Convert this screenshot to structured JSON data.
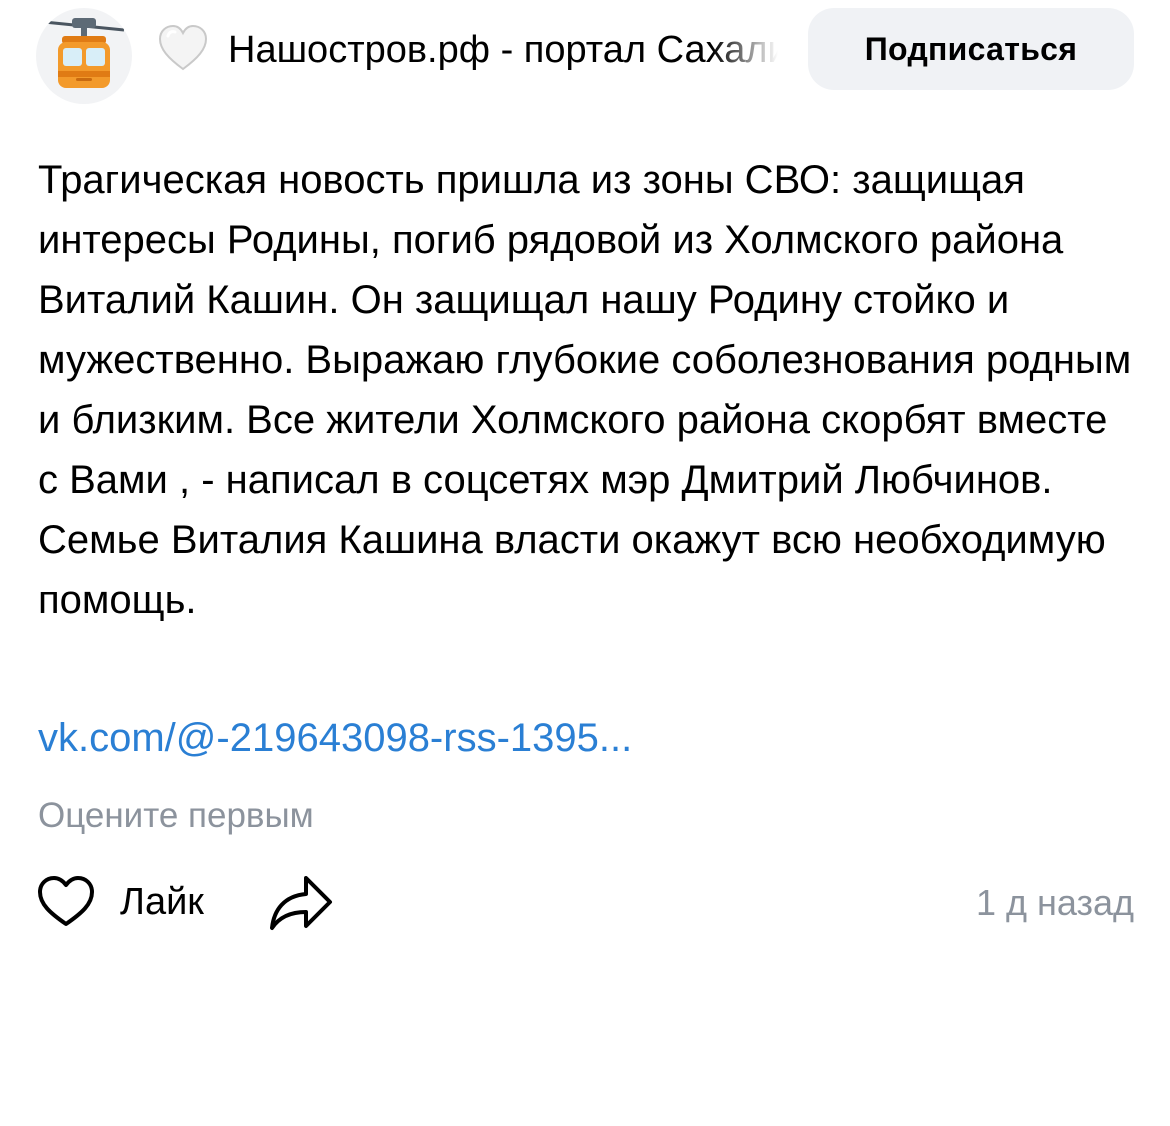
{
  "header": {
    "avatar_icon": "cable-car-icon",
    "heart_icon": "white-heart-emoji-icon",
    "channel_name": "Нашостров.рф - портал Сахалина",
    "subscribe_label": "Подписаться"
  },
  "post": {
    "text": "Трагическая новость пришла из зоны СВО: защищая интересы Родины, погиб рядовой из Холмского района Виталий Кашин. Он защищал нашу Родину стойко и мужественно. Выражаю глубокие соболезнования родным и близким. Все жители Холмского района скорбят вместе с Вами , - написал в соцсетях мэр Дмитрий Любчинов. Семье Виталия Кашина власти окажут всю необходимую помощь.",
    "link": "vk.com/@-219643098-rss-1395..."
  },
  "footer": {
    "rate_prompt": "Оцените первым",
    "like_icon": "heart-outline-icon",
    "like_label": "Лайк",
    "share_icon": "share-arrow-icon",
    "timestamp": "1 д назад"
  },
  "colors": {
    "link": "#2a7fd4",
    "secondary_text": "#8c939d",
    "button_bg": "#f0f2f5",
    "cabin_orange": "#f39a2b"
  }
}
